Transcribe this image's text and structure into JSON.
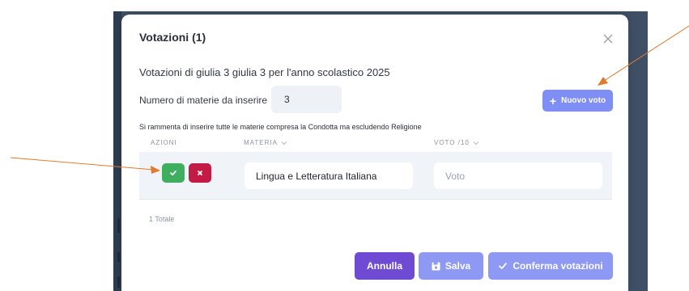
{
  "modal": {
    "title": "Votazioni (1)",
    "subtitle": "Votazioni di giulia 3 giulia 3 per l'anno scolastico 2025",
    "count_label": "Numero di materie da inserire",
    "count_value": "3",
    "new_vote_label": "Nuovo voto",
    "reminder": "Si rammenta di inserire tutte le materie compresa la Condotta ma escludendo Religione"
  },
  "table": {
    "headers": {
      "azioni": "AZIONI",
      "materia": "MATERIA",
      "voto": "VOTO /10"
    },
    "rows": [
      {
        "materia": "Lingua e Letteratura Italiana",
        "voto_placeholder": "Voto"
      }
    ],
    "total": "1 Totale"
  },
  "footer": {
    "cancel_label": "Annulla",
    "save_label": "Salva",
    "confirm_label": "Conferma votazioni"
  },
  "colors": {
    "accent": "#7f8ef5",
    "primary": "#6f4bd4",
    "success": "#3fae5e",
    "danger": "#c21b45",
    "annotation_arrow": "#e07a2e"
  },
  "icons": [
    "close-icon",
    "plus-icon",
    "check-icon",
    "x-icon",
    "save-icon",
    "chevron-down-icon"
  ]
}
